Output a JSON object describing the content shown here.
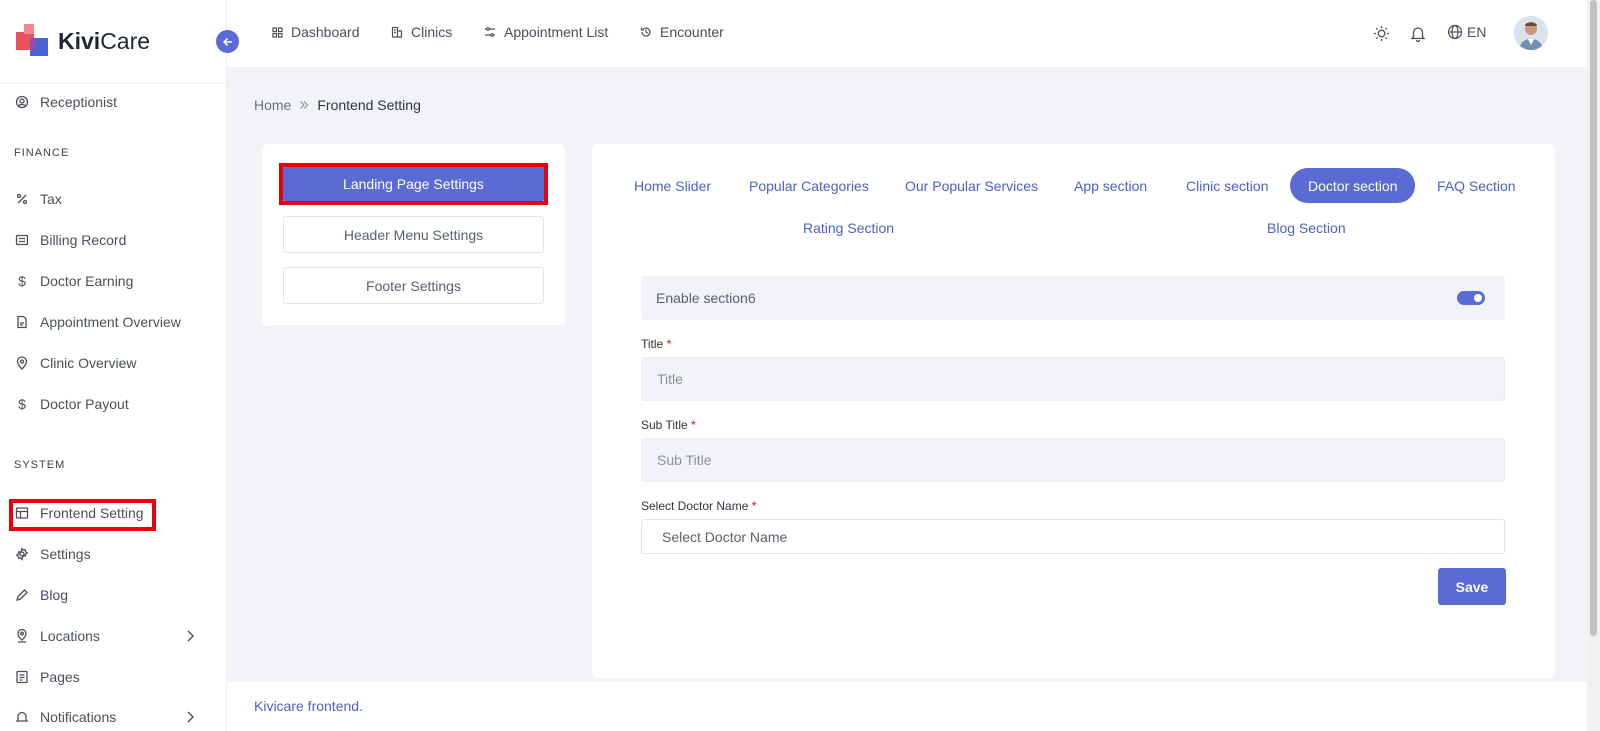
{
  "app": {
    "name_bold": "Kivi",
    "name_rest": "Care"
  },
  "sidebar": {
    "items_top": [
      {
        "label": "Receptionist",
        "icon": "receptionist-icon"
      }
    ],
    "finance_label": "FINANCE",
    "finance_items": [
      {
        "label": "Tax",
        "icon": "percent-icon"
      },
      {
        "label": "Billing Record",
        "icon": "billing-icon"
      },
      {
        "label": "Doctor Earning",
        "icon": "dollar-icon"
      },
      {
        "label": "Appointment Overview",
        "icon": "report-icon"
      },
      {
        "label": "Clinic Overview",
        "icon": "location-pin-icon"
      },
      {
        "label": "Doctor Payout",
        "icon": "dollar-icon"
      }
    ],
    "system_label": "SYSTEM",
    "system_items": [
      {
        "label": "Frontend Setting",
        "icon": "layout-icon"
      },
      {
        "label": "Settings",
        "icon": "gear-icon"
      },
      {
        "label": "Blog",
        "icon": "pencil-icon"
      },
      {
        "label": "Locations",
        "icon": "location-pin-icon"
      },
      {
        "label": "Pages",
        "icon": "pages-icon"
      },
      {
        "label": "Notifications",
        "icon": "bell-icon"
      }
    ]
  },
  "topbar": {
    "links": [
      {
        "label": "Dashboard",
        "icon": "grid-icon"
      },
      {
        "label": "Clinics",
        "icon": "building-icon"
      },
      {
        "label": "Appointment List",
        "icon": "sliders-icon"
      },
      {
        "label": "Encounter",
        "icon": "history-icon"
      }
    ],
    "language": "EN"
  },
  "breadcrumb": {
    "home": "Home",
    "current": "Frontend Setting"
  },
  "settings_menu": [
    {
      "label": "Landing Page Settings",
      "active": true
    },
    {
      "label": "Header Menu Settings",
      "active": false
    },
    {
      "label": "Footer Settings",
      "active": false
    }
  ],
  "tabs": [
    {
      "label": "Home Slider"
    },
    {
      "label": "Popular Categories"
    },
    {
      "label": "Our Popular Services"
    },
    {
      "label": "App section"
    },
    {
      "label": "Clinic section"
    },
    {
      "label": "Doctor section",
      "active": true
    },
    {
      "label": "FAQ Section"
    },
    {
      "label": "Rating Section"
    },
    {
      "label": "Blog Section"
    }
  ],
  "form": {
    "enable_label": "Enable section6",
    "enabled": true,
    "title_label": "Title",
    "title_placeholder": "Title",
    "subtitle_label": "Sub Title",
    "subtitle_placeholder": "Sub Title",
    "doctor_label": "Select Doctor Name",
    "doctor_placeholder": "Select Doctor Name",
    "required_mark": "*",
    "save_label": "Save"
  },
  "footer": {
    "link": "Kivicare frontend",
    "suffix": "."
  },
  "colors": {
    "primary": "#5a6bd5",
    "highlight": "#e8000b",
    "logo_red": "#e9525b",
    "logo_blue": "#4a64d6"
  }
}
